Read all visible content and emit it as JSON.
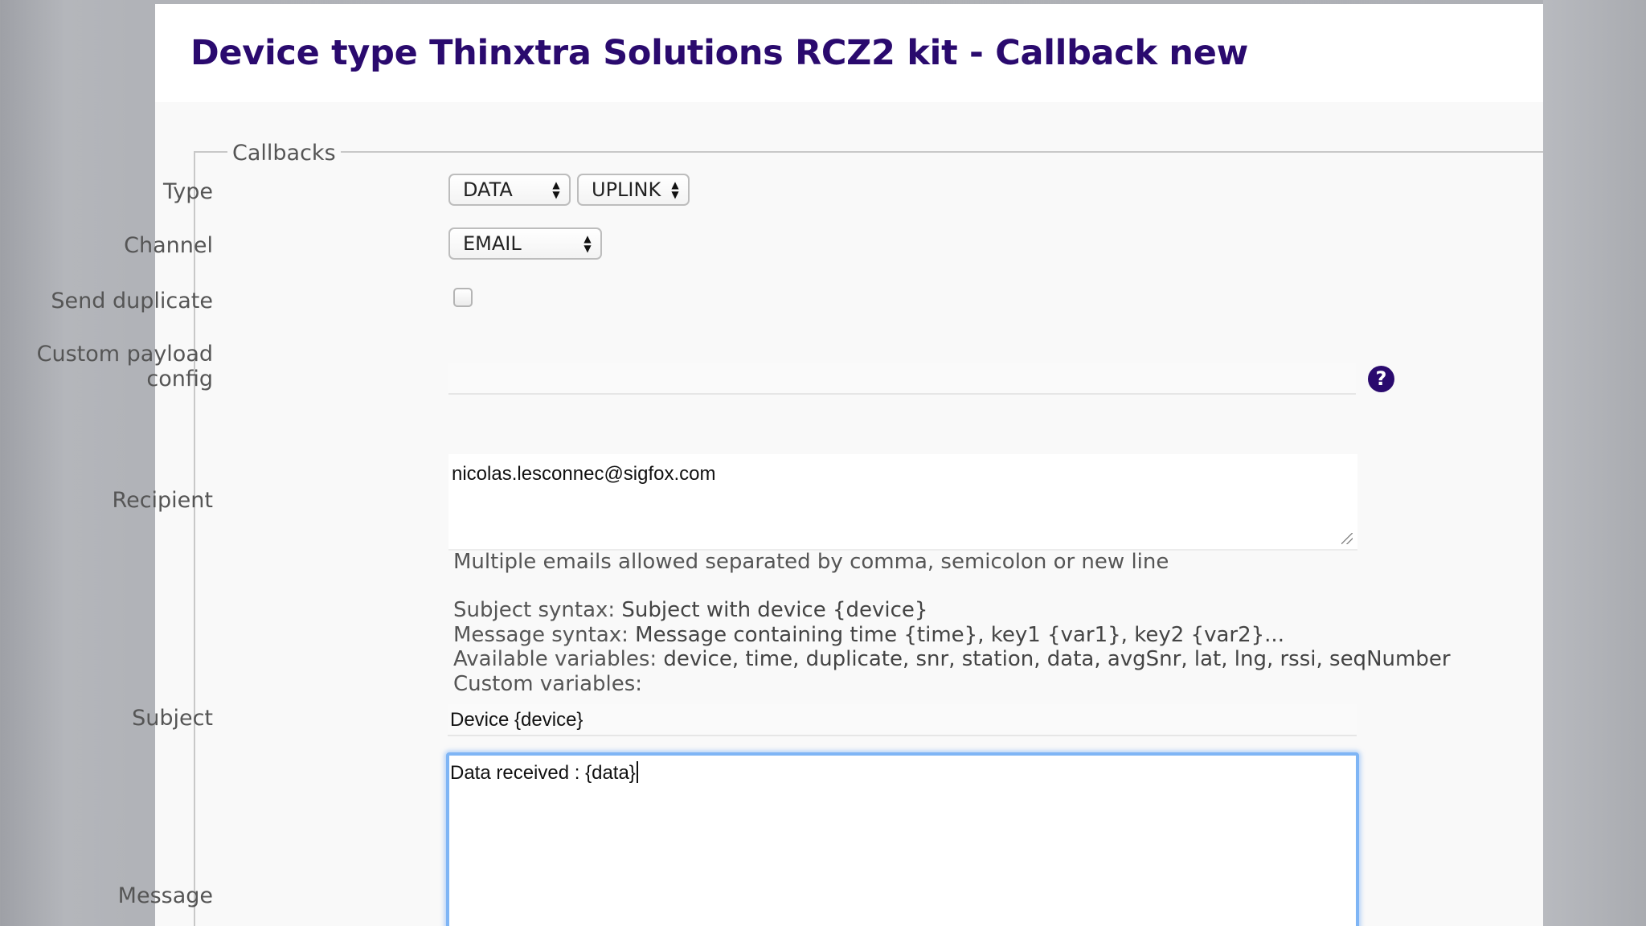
{
  "page": {
    "title": "Device type Thinxtra Solutions RCZ2 kit - Callback new"
  },
  "form": {
    "legend": "Callbacks",
    "type": {
      "label": "Type",
      "select1_value": "DATA",
      "select2_value": "UPLINK"
    },
    "channel": {
      "label": "Channel",
      "value": "EMAIL"
    },
    "send_duplicate": {
      "label": "Send duplicate",
      "checked": false
    },
    "custom_payload": {
      "label_line1": "Custom payload",
      "label_line2": "config",
      "value": ""
    },
    "recipient": {
      "label": "Recipient",
      "value": "nicolas.lesconnec@sigfox.com",
      "hint": "Multiple emails allowed separated by comma, semicolon or new line"
    },
    "syntax_help": {
      "subject_prefix": "Subject syntax: ",
      "subject_example": "Subject with device {device}",
      "message_prefix": "Message syntax: ",
      "message_example": "Message containing time {time}, key1 {var1}, key2 {var2}...",
      "available_prefix": "Available variables: ",
      "available_list": "device, time, duplicate, snr, station, data, avgSnr, lat, lng, rssi, seqNumber",
      "custom_prefix": "Custom variables:"
    },
    "subject": {
      "label": "Subject",
      "value": "Device {device}"
    },
    "message": {
      "label": "Message",
      "value": "Data received : {data}"
    }
  },
  "icons": {
    "help": "question-mark-circle-icon",
    "select_arrows": "up-down-arrows-icon"
  },
  "colors": {
    "title": "#2a0a6e",
    "help_icon": "#2a0a6e",
    "focus_ring": "#7fb5f5"
  }
}
